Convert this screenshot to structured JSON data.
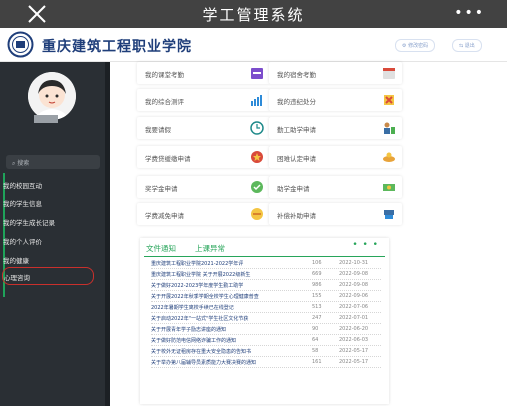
{
  "app_title": "学工管理系统",
  "header": {
    "school_name": "重庆建筑工程职业学院",
    "btn_change_pwd": "修改密码",
    "btn_logout": "退出"
  },
  "sidebar": {
    "search_placeholder": "搜索",
    "items": [
      {
        "label": "我的校园互动"
      },
      {
        "label": "我的学生信息"
      },
      {
        "label": "我的学生成长记录"
      },
      {
        "label": "我的个人评价"
      },
      {
        "label": "我的健康"
      },
      {
        "label": "心理咨询"
      }
    ]
  },
  "cards": [
    {
      "label": "我的课堂考勤",
      "icon": "calendar-purple-icon"
    },
    {
      "label": "我的宿舍考勤",
      "icon": "calendar-red-icon"
    },
    {
      "label": "我的综合测评",
      "icon": "bar-chart-icon"
    },
    {
      "label": "我的违纪处分",
      "icon": "warning-hand-icon"
    },
    {
      "label": "我要请假",
      "icon": "clock-icon"
    },
    {
      "label": "勤工助学申请",
      "icon": "worker-icon"
    },
    {
      "label": "学费贷缓缴申请",
      "icon": "star-badge-icon"
    },
    {
      "label": "困难认定申请",
      "icon": "hand-icon"
    },
    {
      "label": "奖学金申请",
      "icon": "medal-icon"
    },
    {
      "label": "助学金申请",
      "icon": "money-icon"
    },
    {
      "label": "学费减免申请",
      "icon": "minus-icon"
    },
    {
      "label": "补偿补助申请",
      "icon": "coins-icon"
    }
  ],
  "notice_panel": {
    "tab_notice": "文件通知",
    "tab_report": "上课异常",
    "more": "• • •",
    "rows": [
      {
        "title": "重庆建筑工程职业学院2021-2022学年评",
        "count": "106",
        "date": "2022-10-31"
      },
      {
        "title": "重庆建筑工程职业学院 关于开展2022级新生",
        "count": "669",
        "date": "2022-09-08"
      },
      {
        "title": "关于做好2022-2023学年度学生勤工助学",
        "count": "986",
        "date": "2022-09-08"
      },
      {
        "title": "关于开展2022年秋季学期全校学生心理健康普查",
        "count": "155",
        "date": "2022-09-06"
      },
      {
        "title": "2022年暑期学生离校手续已在线登记",
        "count": "513",
        "date": "2022-07-06"
      },
      {
        "title": "关于启动2022年\"一站式\"学生社区文化节获",
        "count": "247",
        "date": "2022-07-01"
      },
      {
        "title": "关于开展青年学子励志讲座的通知",
        "count": "90",
        "date": "2022-06-20"
      },
      {
        "title": "关于做好防范电信网络诈骗工作的通知",
        "count": "64",
        "date": "2022-06-03"
      },
      {
        "title": "关于校外无证租房存在重大安全隐患的告知书",
        "count": "58",
        "date": "2022-05-17"
      },
      {
        "title": "关于举办第八届辅导员素质能力大赛决赛的通知",
        "count": "161",
        "date": "2022-05-17"
      }
    ]
  }
}
